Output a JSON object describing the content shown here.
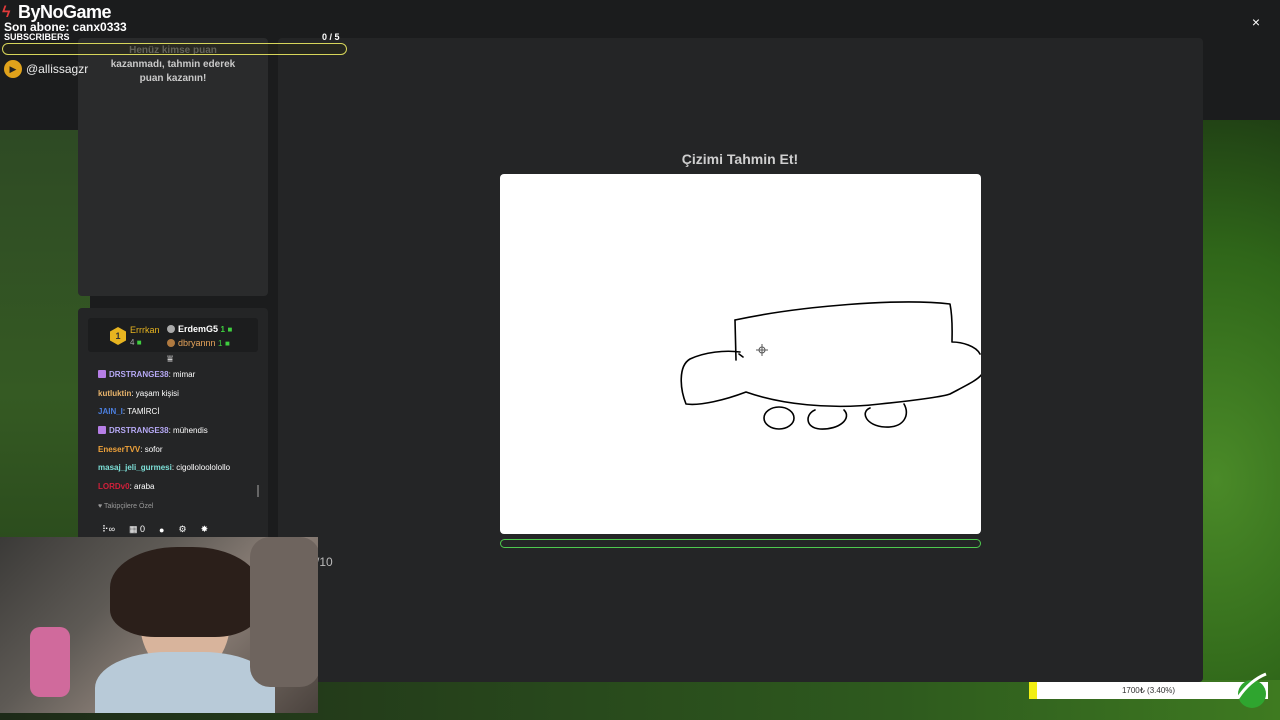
{
  "overlay": {
    "brand": "ByNoGame",
    "last_subscriber": "Son abone: canx0333",
    "subscribers_label": "SUBSCRIBERS",
    "subscribers_count": "0 / 5",
    "instagram_handle": "@allissagzr",
    "goal_text": "1700₺ (3.40%)",
    "goal_progress_percent": 3.4
  },
  "leaderboard": {
    "empty_line1": "Henüz kimse puan",
    "empty_line2": "kazanmadı, tahmin ederek",
    "empty_line3": "puan kazanın!"
  },
  "game": {
    "title": "Çizimi Tahmin Et!",
    "round_counter": "/10",
    "close_symbol": "×"
  },
  "chat": {
    "top_rank": "1",
    "top_name": "Errrkan",
    "top_score": "4",
    "second_name": "ErdemG5",
    "second_score": "1",
    "third_name": "dbryannn",
    "third_score": "1",
    "messages": [
      {
        "user": "DRSTRANGE38",
        "text": "mimar",
        "color": "#b6a9f5",
        "gift": true
      },
      {
        "user": "kutluktin",
        "text": "yaşam kişisi",
        "color": "#e8b46b",
        "gift": false
      },
      {
        "user": "JAIN_I",
        "text": "TAMİRCİ",
        "color": "#4b7fe0",
        "gift": false
      },
      {
        "user": "DRSTRANGE38",
        "text": "mühendis",
        "color": "#b6a9f5",
        "gift": true
      },
      {
        "user": "EneserTVV",
        "text": "sofor",
        "color": "#f0a33b",
        "gift": false
      },
      {
        "user": "masaj_jeli_gurmesi",
        "text": "cigolloloololollo",
        "color": "#7de0d8",
        "gift": false
      },
      {
        "user": "LORDv0",
        "text": "araba",
        "color": "#d0203a",
        "gift": false
      }
    ],
    "followers_only": "Takipçilere Özel",
    "toolbar_count": "0",
    "toolbar_infinity": "∞"
  }
}
